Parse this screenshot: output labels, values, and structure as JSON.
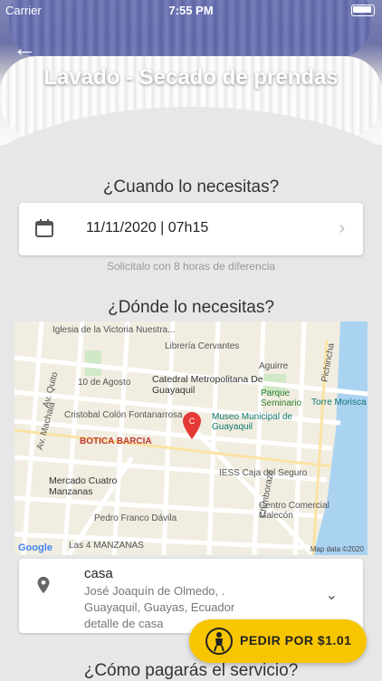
{
  "status_bar": {
    "carrier": "Carrier",
    "time": "7:55 PM"
  },
  "header": {
    "title": "Lavado - Secado de prendas",
    "back_icon": "back-arrow-icon"
  },
  "when": {
    "title": "¿Cuando lo necesitas?",
    "datetime": "11/11/2020 | 07h15",
    "hint": "Solicitalo con 8 horas de diferencia"
  },
  "where": {
    "title": "¿Dónde lo necesitas?",
    "map": {
      "labels": [
        "Iglesia de la Victoria Nuestra...",
        "Librería Cervantes",
        "Aguirre",
        "10 de Agosto",
        "Catedral Metropolitana De Guayaquil",
        "Parque Seminario",
        "Torre Morisca",
        "Cristobal Colón Fontanarrosa",
        "Museo Municipal de Guayaquil",
        "BOTICA BARCIA",
        "IESS Caja del Seguro",
        "Mercado Cuatro Manzanas",
        "Centro Comercial Malecón",
        "Pedro Franco Dávila",
        "Las 4 MANZANAS",
        "Av. Quito",
        "Av. Machala",
        "Chimborazo",
        "Pichincha"
      ],
      "google": "Google",
      "attribution": "Map data ©2020"
    }
  },
  "address": {
    "name": "casa",
    "line1": "José Joaquín de Olmedo, .",
    "line2": "Guayaquil, Guayas, Ecuador",
    "line3": "detalle de casa"
  },
  "payment": {
    "title": "¿Cómo pagarás el servicio?"
  },
  "order_button": {
    "label": "PEDIR POR $1.01"
  },
  "colors": {
    "accent": "#f7c600",
    "pin": "#e53935",
    "background": "#e7e7e7"
  }
}
